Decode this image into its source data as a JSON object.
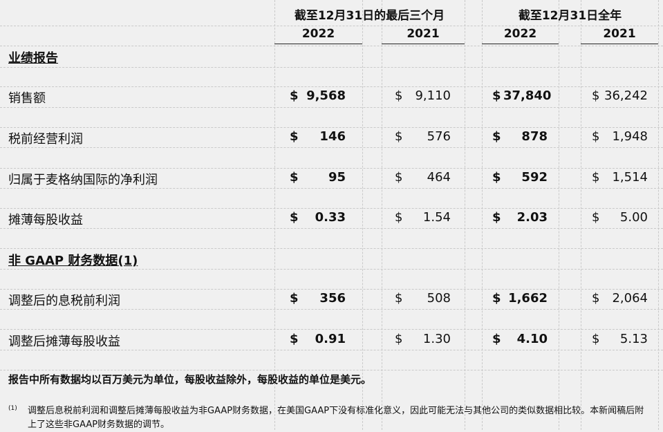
{
  "header": {
    "q4_label": "截至12月31日的最后三个月",
    "fy_label": "截至12月31日全年",
    "years": [
      "2022",
      "2021",
      "2022",
      "2021"
    ]
  },
  "sections": {
    "performance": "业绩报告",
    "non_gaap": "非 GAAP 财务数据(1)"
  },
  "currency_symbol": "$",
  "rows": [
    {
      "label": "销售额",
      "values": [
        "9,568",
        "9,110",
        "37,840",
        "36,242"
      ]
    },
    {
      "label": "税前经营利润",
      "values": [
        "146",
        "576",
        "878",
        "1,948"
      ]
    },
    {
      "label": "归属于麦格纳国际的净利润",
      "values": [
        "95",
        "464",
        "592",
        "1,514"
      ]
    },
    {
      "label": "摊薄每股收益",
      "values": [
        "0.33",
        "1.54",
        "2.03",
        "5.00"
      ]
    },
    {
      "label": "调整后的息税前利润",
      "values": [
        "356",
        "508",
        "1,662",
        "2,064"
      ]
    },
    {
      "label": "调整后摊薄每股收益",
      "values": [
        "0.91",
        "1.30",
        "4.10",
        "5.13"
      ]
    }
  ],
  "note": "报告中所有数据均以百万美元为单位，每股收益除外，每股收益的单位是美元。",
  "footnote": {
    "mark": "(1)",
    "text": "调整后息税前利润和调整后摊薄每股收益为非GAAP财务数据，在美国GAAP下没有标准化意义，因此可能无法与其他公司的类似数据相比较。本新闻稿后附上了这些非GAAP财务数据的调节。"
  }
}
